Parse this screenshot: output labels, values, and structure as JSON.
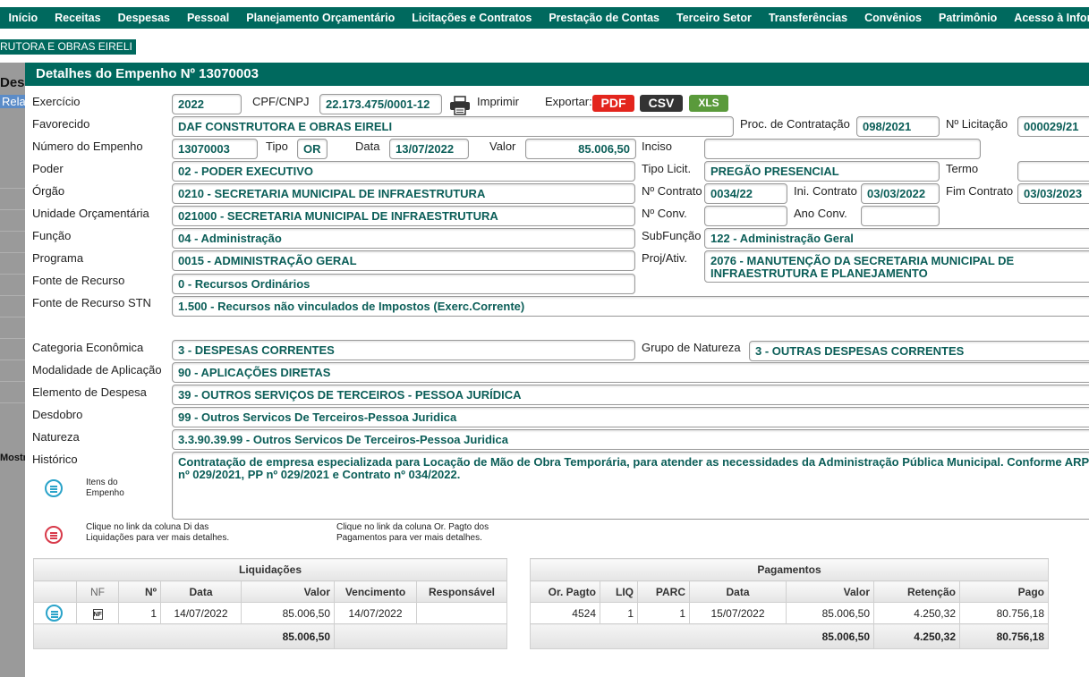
{
  "nav": [
    "Início",
    "Receitas",
    "Despesas",
    "Pessoal",
    "Planejamento Orçamentário",
    "Licitações e Contratos",
    "Prestação de Contas",
    "Terceiro Setor",
    "Transferências",
    "Convênios",
    "Patrimônio",
    "Acesso à Informação"
  ],
  "company_strip": "RUTORA E OBRAS EIRELI",
  "background": {
    "title": "Des",
    "tab": "Rela",
    "footer": "Mostr"
  },
  "modal": {
    "title": "Detalhes do Empenho Nº 13070003",
    "print_label": "Imprimir",
    "export_label": "Exportar:",
    "export_pdf": "PDF",
    "export_csv": "CSV",
    "export_xls": "XLS"
  },
  "labels": {
    "exercicio": "Exercício",
    "cpf": "CPF/CNPJ",
    "favorecido": "Favorecido",
    "proc": "Proc. de Contratação",
    "nlicitacao": "Nº Licitação",
    "numero": "Número do Empenho",
    "tipo": "Tipo",
    "data": "Data",
    "valor": "Valor",
    "inciso": "Inciso",
    "poder": "Poder",
    "tipo_licit": "Tipo Licit.",
    "termo": "Termo",
    "orgao": "Órgão",
    "ncontrato": "Nº Contrato",
    "ini_contrato": "Ini. Contrato",
    "fim_contrato": "Fim Contrato",
    "unidade": "Unidade Orçamentária",
    "nconv": "Nº Conv.",
    "ano_conv": "Ano Conv.",
    "funcao": "Função",
    "subfuncao": "SubFunção",
    "programa": "Programa",
    "projativ": "Proj/Ativ.",
    "fonte": "Fonte de Recurso",
    "fonte_stn": "Fonte de Recurso STN",
    "categoria": "Categoria Econômica",
    "grupo": "Grupo de Natureza",
    "modalidade": "Modalidade de Aplicação",
    "elemento": "Elemento de Despesa",
    "desdobro": "Desdobro",
    "natureza": "Natureza",
    "historico": "Histórico"
  },
  "values": {
    "exercicio": "2022",
    "cpf": "22.173.475/0001-12",
    "favorecido": "DAF CONSTRUTORA E OBRAS EIRELI",
    "proc": "098/2021",
    "nlicitacao": "000029/21",
    "numero": "13070003",
    "tipo": "OR",
    "data": "13/07/2022",
    "valor": "85.006,50",
    "inciso": "",
    "poder": "02 - PODER EXECUTIVO",
    "tipo_licit": "PREGÃO PRESENCIAL",
    "termo": "",
    "orgao": "0210 - SECRETARIA MUNICIPAL DE INFRAESTRUTURA",
    "ncontrato": "0034/22",
    "ini_contrato": "03/03/2022",
    "fim_contrato": "03/03/2023",
    "unidade": "021000 - SECRETARIA MUNICIPAL DE INFRAESTRUTURA",
    "nconv": "",
    "ano_conv": "",
    "funcao": "04 - Administração",
    "subfuncao": "122 - Administração Geral",
    "programa": "0015 - ADMINISTRAÇÃO GERAL",
    "projativ": "2076 - MANUTENÇÃO DA SECRETARIA MUNICIPAL DE INFRAESTRUTURA E PLANEJAMENTO",
    "fonte": "0 - Recursos Ordinários",
    "fonte_stn": "1.500 - Recursos não vinculados de Impostos (Exerc.Corrente)",
    "categoria": "3 - DESPESAS CORRENTES",
    "grupo": "3 - OUTRAS DESPESAS CORRENTES",
    "modalidade": "90 - APLICAÇÕES DIRETAS",
    "elemento": "39 - OUTROS SERVIÇOS DE TERCEIROS - PESSOA JURÍDICA",
    "desdobro": "99 - Outros Servicos De Terceiros-Pessoa Juridica",
    "natureza": "3.3.90.39.99 - Outros Servicos De Terceiros-Pessoa Juridica",
    "historico": "Contratação de empresa especializada para Locação de Mão de Obra Temporária, para atender as necessidades da Administração Pública Municipal. Conforme ARP nº 029/2021, PP nº 029/2021 e Contrato nº 034/2022."
  },
  "notes": {
    "itens": "Itens do Empenho",
    "liq_hint": "Clique no link da coluna Di das Liquidações para ver mais detalhes.",
    "pag_hint": "Clique no link da coluna Or. Pagto dos Pagamentos para ver mais detalhes."
  },
  "liquidacoes": {
    "caption": "Liquidações",
    "headers": [
      "",
      "NF",
      "Nº",
      "Data",
      "Valor",
      "Vencimento",
      "Responsável"
    ],
    "rows": [
      {
        "nf": "NF",
        "n": "1",
        "data": "14/07/2022",
        "valor": "85.006,50",
        "vencimento": "14/07/2022",
        "responsavel": ""
      }
    ],
    "total": "85.006,50"
  },
  "pagamentos": {
    "caption": "Pagamentos",
    "headers": [
      "Or. Pagto",
      "LIQ",
      "PARC",
      "Data",
      "Valor",
      "Retenção",
      "Pago"
    ],
    "rows": [
      {
        "or": "4524",
        "liq": "1",
        "parc": "1",
        "data": "15/07/2022",
        "valor": "85.006,50",
        "retencao": "4.250,32",
        "pago": "80.756,18"
      }
    ],
    "total": {
      "valor": "85.006,50",
      "retencao": "4.250,32",
      "pago": "80.756,18"
    }
  },
  "colors": {
    "primary": "#00695e",
    "field_text": "#0b5e58",
    "pdf": "#e3251d",
    "csv": "#333333",
    "xls": "#5a9a3b"
  }
}
